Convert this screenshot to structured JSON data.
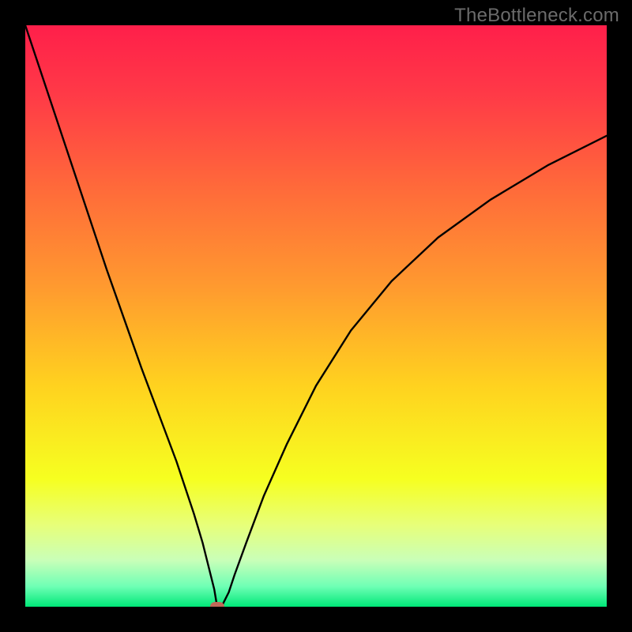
{
  "watermark": {
    "text": "TheBottleneck.com"
  },
  "colors": {
    "gradient_stops": [
      {
        "offset": 0.0,
        "color": "#ff1f4a"
      },
      {
        "offset": 0.12,
        "color": "#ff3a47"
      },
      {
        "offset": 0.28,
        "color": "#ff6a3a"
      },
      {
        "offset": 0.45,
        "color": "#ff9a2f"
      },
      {
        "offset": 0.62,
        "color": "#ffd21f"
      },
      {
        "offset": 0.78,
        "color": "#f6ff20"
      },
      {
        "offset": 0.86,
        "color": "#e7ff7a"
      },
      {
        "offset": 0.92,
        "color": "#c9ffb8"
      },
      {
        "offset": 0.965,
        "color": "#6fffb5"
      },
      {
        "offset": 1.0,
        "color": "#00e878"
      }
    ],
    "curve": "#000000",
    "marker": "#c06858"
  },
  "chart_data": {
    "type": "line",
    "title": "",
    "xlabel": "",
    "ylabel": "",
    "xlim": [
      0,
      100
    ],
    "ylim": [
      0,
      100
    ],
    "grid": false,
    "legend": false,
    "min_point": {
      "x": 33,
      "y": 0
    },
    "series": [
      {
        "name": "bottleneck-curve",
        "x": [
          0,
          2,
          5,
          8,
          11,
          14,
          17,
          20,
          23,
          26,
          29,
          30.5,
          31.5,
          32.5,
          33,
          34,
          35,
          36,
          38,
          41,
          45,
          50,
          56,
          63,
          71,
          80,
          90,
          100
        ],
        "y": [
          100,
          94,
          85,
          76,
          67,
          58,
          49.5,
          41,
          33,
          25,
          16,
          11,
          7,
          3,
          0,
          0.5,
          2.5,
          5.5,
          11,
          19,
          28,
          38,
          47.5,
          56,
          63.5,
          70,
          76,
          81
        ]
      }
    ]
  }
}
